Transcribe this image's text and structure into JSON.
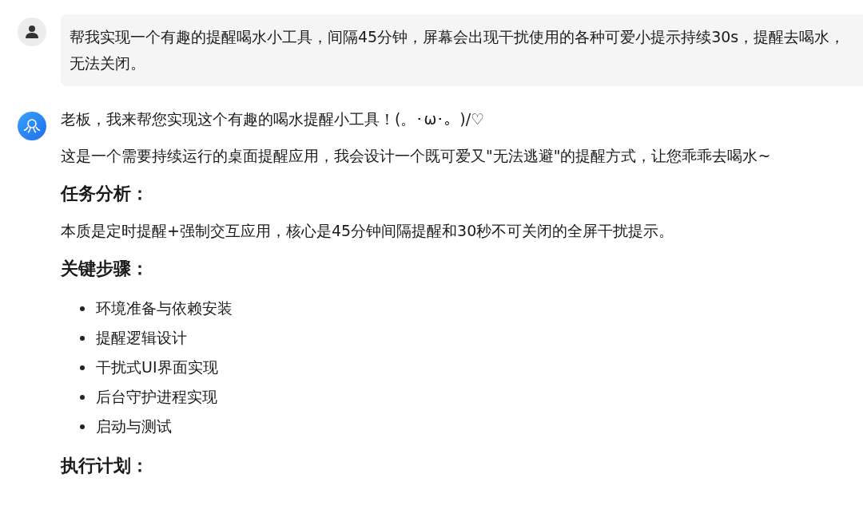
{
  "user_message": {
    "text": "帮我实现一个有趣的提醒喝水小工具，间隔45分钟，屏幕会出现干扰使用的各种可爱小提示持续30s，提醒去喝水，无法关闭。"
  },
  "assistant_message": {
    "blocks": [
      {
        "kind": "paragraph",
        "text": "老板，我来帮您实现这个有趣的喝水提醒小工具！(。･ω･。)/♡"
      },
      {
        "kind": "paragraph",
        "text": "这是一个需要持续运行的桌面提醒应用，我会设计一个既可爱又\"无法逃避\"的提醒方式，让您乖乖去喝水~"
      },
      {
        "kind": "heading",
        "text": "任务分析："
      },
      {
        "kind": "paragraph",
        "text": "本质是定时提醒+强制交互应用，核心是45分钟间隔提醒和30秒不可关闭的全屏干扰提示。"
      },
      {
        "kind": "heading",
        "text": "关键步骤："
      },
      {
        "kind": "list",
        "items": [
          "环境准备与依赖安装",
          "提醒逻辑设计",
          "干扰式UI界面实现",
          "后台守护进程实现",
          "启动与测试"
        ]
      },
      {
        "kind": "heading",
        "text": "执行计划："
      }
    ]
  }
}
